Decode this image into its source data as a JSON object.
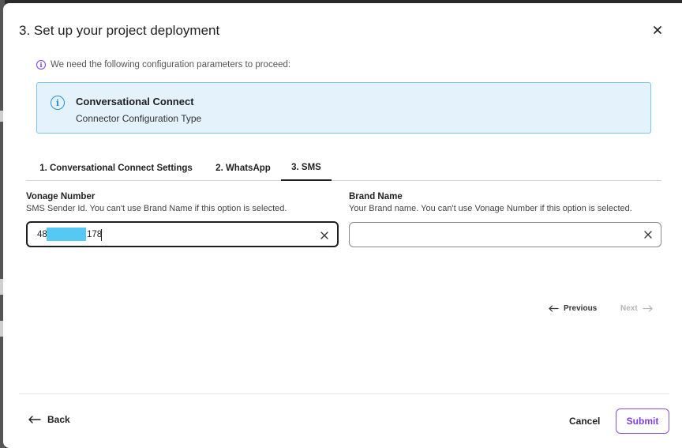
{
  "dialog": {
    "title": "3. Set up your project deployment"
  },
  "notice": {
    "icon": "info-circle-icon",
    "text": "We need the following configuration parameters to proceed:"
  },
  "info_box": {
    "icon": "info-circle-icon",
    "title": "Conversational Connect",
    "subtitle": "Connector Configuration Type"
  },
  "tabs": [
    {
      "label": "1. Conversational Connect Settings",
      "active": false
    },
    {
      "label": "2. WhatsApp",
      "active": false
    },
    {
      "label": "3. SMS",
      "active": true
    }
  ],
  "fields": {
    "vonage_number": {
      "label": "Vonage Number",
      "help": "SMS Sender Id. You can't use Brand Name if this option is selected.",
      "value_prefix": "48",
      "value_suffix": "178"
    },
    "brand_name": {
      "label": "Brand Name",
      "help": "Your Brand name. You can't use Vonage Number if this option is selected.",
      "value": ""
    }
  },
  "pagination": {
    "previous_label": "Previous",
    "next_label": "Next"
  },
  "footer": {
    "back_label": "Back",
    "cancel_label": "Cancel",
    "submit_label": "Submit"
  },
  "colors": {
    "accent": "#7b3fe4",
    "info_bg": "#e3f2fb",
    "info_border": "#7cc4ec",
    "redaction": "#56c8f4"
  }
}
